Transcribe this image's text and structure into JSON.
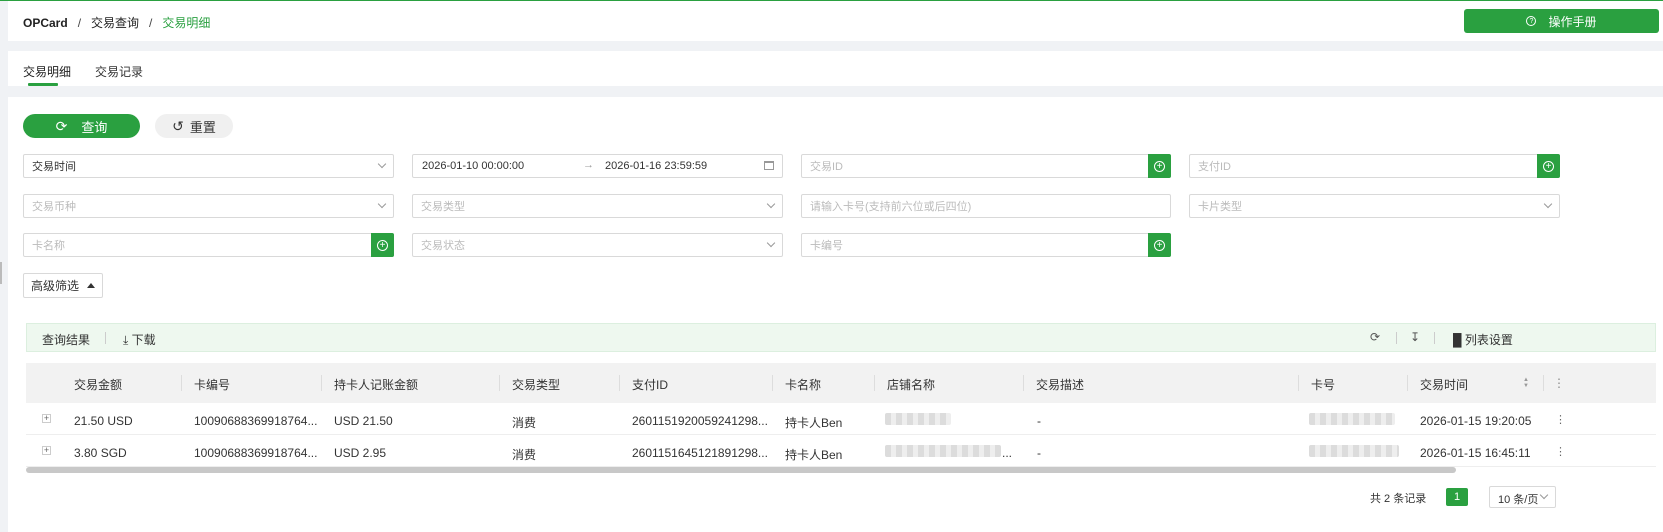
{
  "breadcrumb": {
    "root": "OPCard",
    "level1": "交易查询",
    "current": "交易明细",
    "separator": "/"
  },
  "header": {
    "manual_label": "操作手册",
    "manual_icon": "help-circle-icon"
  },
  "tabs": [
    {
      "label": "交易明细",
      "active": true
    },
    {
      "label": "交易记录",
      "active": false
    }
  ],
  "actions": {
    "query_label": "查询",
    "reset_label": "重置"
  },
  "filters": {
    "time_type": "交易时间",
    "date_start": "2026-01-10 00:00:00",
    "date_arrow": "→",
    "date_end": "2026-01-16 23:59:59",
    "txn_id_placeholder": "交易ID",
    "pay_id_placeholder": "支付ID",
    "currency_placeholder": "交易币种",
    "txn_type_placeholder": "交易类型",
    "card_no_placeholder": "请输入卡号(支持前六位或后四位)",
    "card_type_placeholder": "卡片类型",
    "card_name_placeholder": "卡名称",
    "txn_status_placeholder": "交易状态",
    "card_code_placeholder": "卡编号"
  },
  "advanced_filter_label": "高级筛选",
  "toolbar": {
    "result_label": "查询结果",
    "download_label": "下载",
    "column_settings_label": "列表设置"
  },
  "table": {
    "columns": [
      "交易金额",
      "卡编号",
      "持卡人记账金额",
      "交易类型",
      "支付ID",
      "卡名称",
      "店铺名称",
      "交易描述",
      "卡号",
      "交易时间"
    ],
    "rows": [
      {
        "amount": "21.50 USD",
        "card_code": "10090688369918764...",
        "holder_amount": "USD 21.50",
        "type": "消费",
        "pay_id": "2601151920059241298...",
        "card_name": "持卡人Ben",
        "desc": "-",
        "time": "2026-01-15 19:20:05"
      },
      {
        "amount": "3.80 SGD",
        "card_code": "10090688369918764...",
        "holder_amount": "USD 2.95",
        "type": "消费",
        "pay_id": "2601151645121891298...",
        "card_name": "持卡人Ben",
        "shop_suffix": "...",
        "desc": "-",
        "time": "2026-01-15 16:45:11"
      }
    ]
  },
  "pagination": {
    "total": "共 2 条记录",
    "current_page": "1",
    "page_size": "10 条/页"
  },
  "colors": {
    "accent": "#2aa040",
    "toolbar_bg": "#eef8ef"
  }
}
